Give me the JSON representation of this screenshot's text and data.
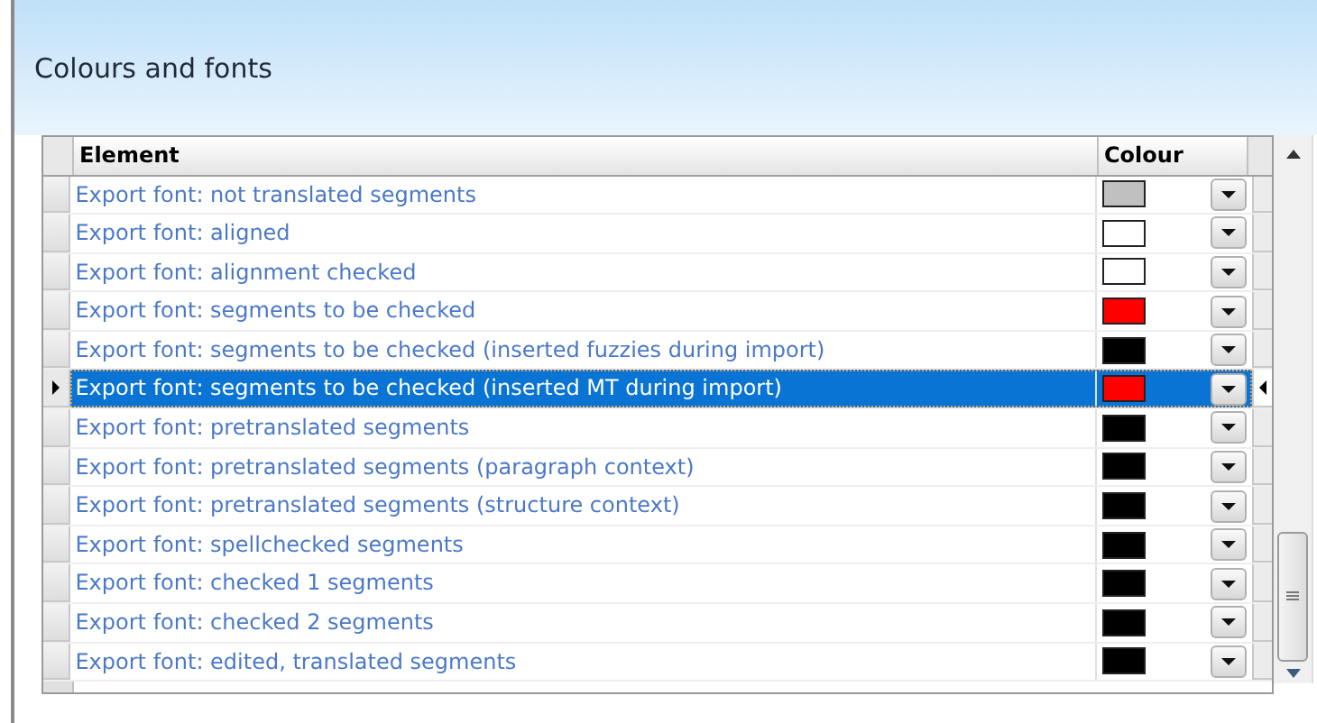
{
  "title": "Colours and fonts",
  "table": {
    "columns": [
      "Element",
      "Colour"
    ],
    "rows": [
      {
        "element": "Export font: not translated segments",
        "color": "#c0c0c0",
        "selected": false
      },
      {
        "element": "Export font: aligned",
        "color": "#ffffff",
        "selected": false
      },
      {
        "element": "Export font: alignment checked",
        "color": "#ffffff",
        "selected": false
      },
      {
        "element": "Export font: segments to be checked",
        "color": "#ff0000",
        "selected": false
      },
      {
        "element": "Export font: segments to be checked (inserted fuzzies during import)",
        "color": "#000000",
        "selected": false
      },
      {
        "element": "Export font: segments to be checked (inserted MT during import)",
        "color": "#ff0000",
        "selected": true
      },
      {
        "element": "Export font: pretranslated segments",
        "color": "#000000",
        "selected": false
      },
      {
        "element": "Export font: pretranslated segments (paragraph context)",
        "color": "#000000",
        "selected": false
      },
      {
        "element": "Export font: pretranslated segments (structure context)",
        "color": "#000000",
        "selected": false
      },
      {
        "element": "Export font: spellchecked segments",
        "color": "#000000",
        "selected": false
      },
      {
        "element": "Export font: checked 1 segments",
        "color": "#000000",
        "selected": false
      },
      {
        "element": "Export font: checked 2 segments",
        "color": "#000000",
        "selected": false
      },
      {
        "element": "Export font: edited, translated segments",
        "color": "#000000",
        "selected": false
      }
    ]
  }
}
